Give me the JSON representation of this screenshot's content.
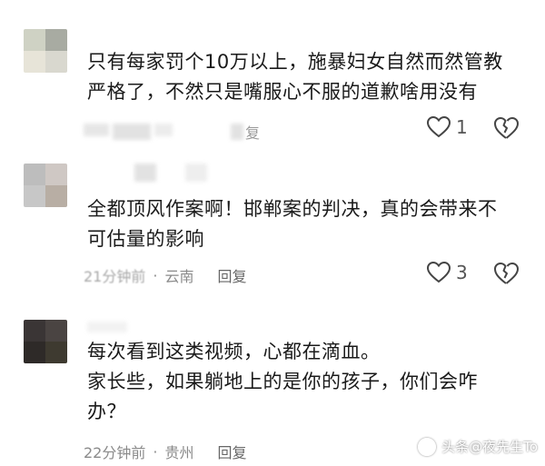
{
  "comments": [
    {
      "text_lines": [
        "只有每家罚个10万以上，施暴妇女自然而然管教",
        "严格了，不然只是嘴服心不服的道歉啥用没有"
      ],
      "reply": "复",
      "likes": "1",
      "avatar_colors": [
        "#cfd2c4",
        "#a8aba2",
        "#e7e4d8",
        "#d9d8cf"
      ]
    },
    {
      "text_lines": [
        "全都顶风作案啊！邯郸案的判决，真的会带来不",
        "可估量的影响"
      ],
      "time": "21分钟前",
      "dot": "·",
      "location": "云南",
      "reply": "回复",
      "likes": "3",
      "avatar_colors": [
        "#bdbdbd",
        "#cfc8c4",
        "#c7c7c7",
        "#b8aea4"
      ]
    },
    {
      "text_lines": [
        "每次看到这类视频，心都在滴血。",
        "家长些，如果躺地上的是你的孩子，你们会咋",
        "办？"
      ],
      "time": "22分钟前",
      "dot": "·",
      "location": "贵州",
      "reply": "回复",
      "avatar_colors": [
        "#3a3535",
        "#4a4442",
        "#2e2a28",
        "#3e3a30"
      ]
    }
  ],
  "watermark": "头条@夜先生To",
  "icons": {
    "like": "heart-outline-icon",
    "dislike": "broken-heart-icon",
    "logo": "toutiao-logo-icon"
  }
}
